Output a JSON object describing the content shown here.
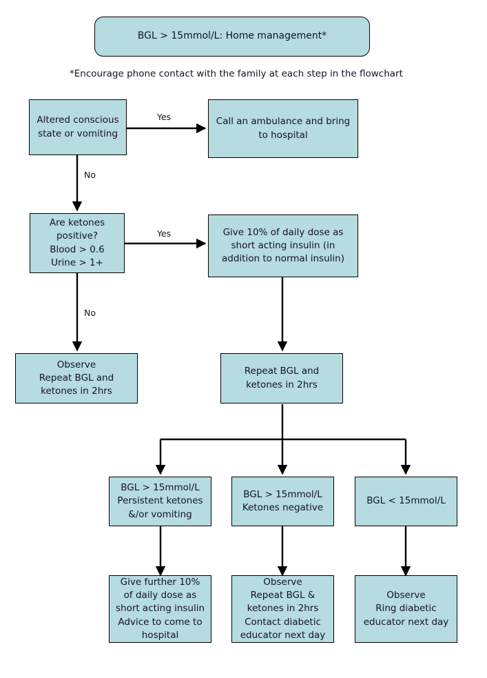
{
  "page": {
    "title": "BGL > 15mmol/L: Home management*",
    "background": "#ffffff",
    "node_fill": "#b6dbe0",
    "node_stroke": "#000000",
    "text_color": "#12122a"
  },
  "header": {
    "label": "BGL > 15mmol/L: Home management*"
  },
  "footnote": {
    "text": "*Encourage phone contact with the family at each step in the flowchart"
  },
  "nodes": [
    {
      "id": "altered",
      "label": "Altered conscious\nstate or vomiting"
    },
    {
      "id": "ambulance",
      "label": "Call an ambulance and bring\nto hospital"
    },
    {
      "id": "ketones",
      "label": "Are ketones\npositive?\nBlood > 0.6\nUrine > 1+"
    },
    {
      "id": "give10",
      "label": "Give 10% of daily dose as\nshort acting insulin (in\naddition to normal insulin)"
    },
    {
      "id": "observe_left",
      "label": "Observe\nRepeat BGL and\nketones in 2hrs"
    },
    {
      "id": "repeat_mid",
      "label": "Repeat BGL and\nketones in 2hrs"
    },
    {
      "id": "branch_high_ket",
      "label": "BGL > 15mmol/L\nPersistent ketones\n&/or vomiting"
    },
    {
      "id": "branch_high_neg",
      "label": "BGL > 15mmol/L\nKetones negative"
    },
    {
      "id": "branch_low",
      "label": "BGL < 15mmol/L"
    },
    {
      "id": "give_further",
      "label": "Give further 10%\nof daily dose as\nshort acting insulin\nAdvice to come to\nhospital"
    },
    {
      "id": "observe_mid",
      "label": "Observe\nRepeat BGL &\nketones in 2hrs\nContact diabetic\neducator next day"
    },
    {
      "id": "observe_right",
      "label": "Observe\nRing diabetic\neducator next day"
    }
  ],
  "edge_labels": [
    {
      "id": "yes1",
      "label": "Yes"
    },
    {
      "id": "no1",
      "label": "No"
    },
    {
      "id": "yes2",
      "label": "Yes"
    },
    {
      "id": "no2",
      "label": "No"
    }
  ]
}
